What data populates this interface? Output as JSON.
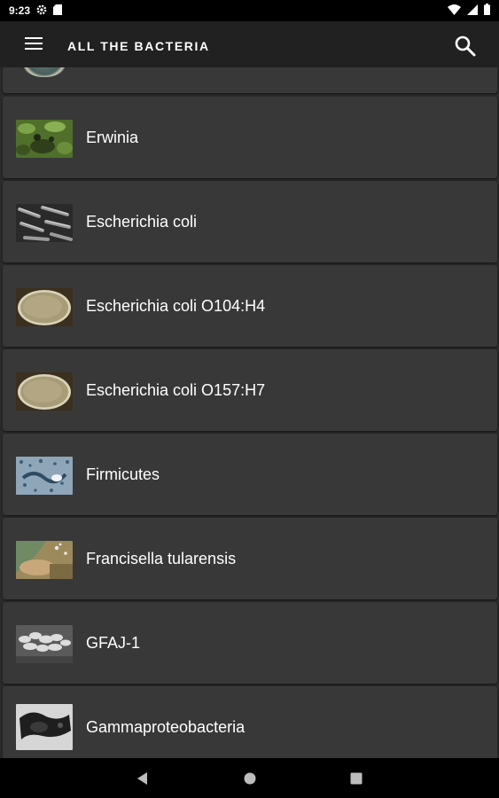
{
  "status_bar": {
    "time": "9:23",
    "icons": [
      "gear-icon",
      "sd-card-icon",
      "wifi-icon",
      "signal-icon",
      "battery-icon"
    ]
  },
  "app_bar": {
    "title": "ALL THE BACTERIA",
    "menu_icon": "hamburger-menu-icon",
    "search_icon": "search-icon"
  },
  "list": {
    "items": [
      {
        "label": "",
        "thumbnail": "petri-dish-thumbnail"
      },
      {
        "label": "Erwinia",
        "thumbnail": "green-plant-thumbnail"
      },
      {
        "label": "Escherichia coli",
        "thumbnail": "rod-bacteria-micrograph-thumbnail"
      },
      {
        "label": "Escherichia coli O104:H4",
        "thumbnail": "petri-dish-thumbnail"
      },
      {
        "label": "Escherichia coli O157:H7",
        "thumbnail": "petri-dish-thumbnail"
      },
      {
        "label": "Firmicutes",
        "thumbnail": "blue-micrograph-thumbnail"
      },
      {
        "label": "Francisella tularensis",
        "thumbnail": "agar-culture-thumbnail"
      },
      {
        "label": "GFAJ-1",
        "thumbnail": "cell-cluster-micrograph-thumbnail"
      },
      {
        "label": "Gammaproteobacteria",
        "thumbnail": "dark-micrograph-thumbnail"
      }
    ]
  },
  "nav_bar": {
    "buttons": [
      "back-icon",
      "home-icon",
      "recents-icon"
    ]
  },
  "colors": {
    "background": "#2b2b2b",
    "card": "#383838",
    "app_bar": "#212121",
    "status_bar": "#000000"
  }
}
